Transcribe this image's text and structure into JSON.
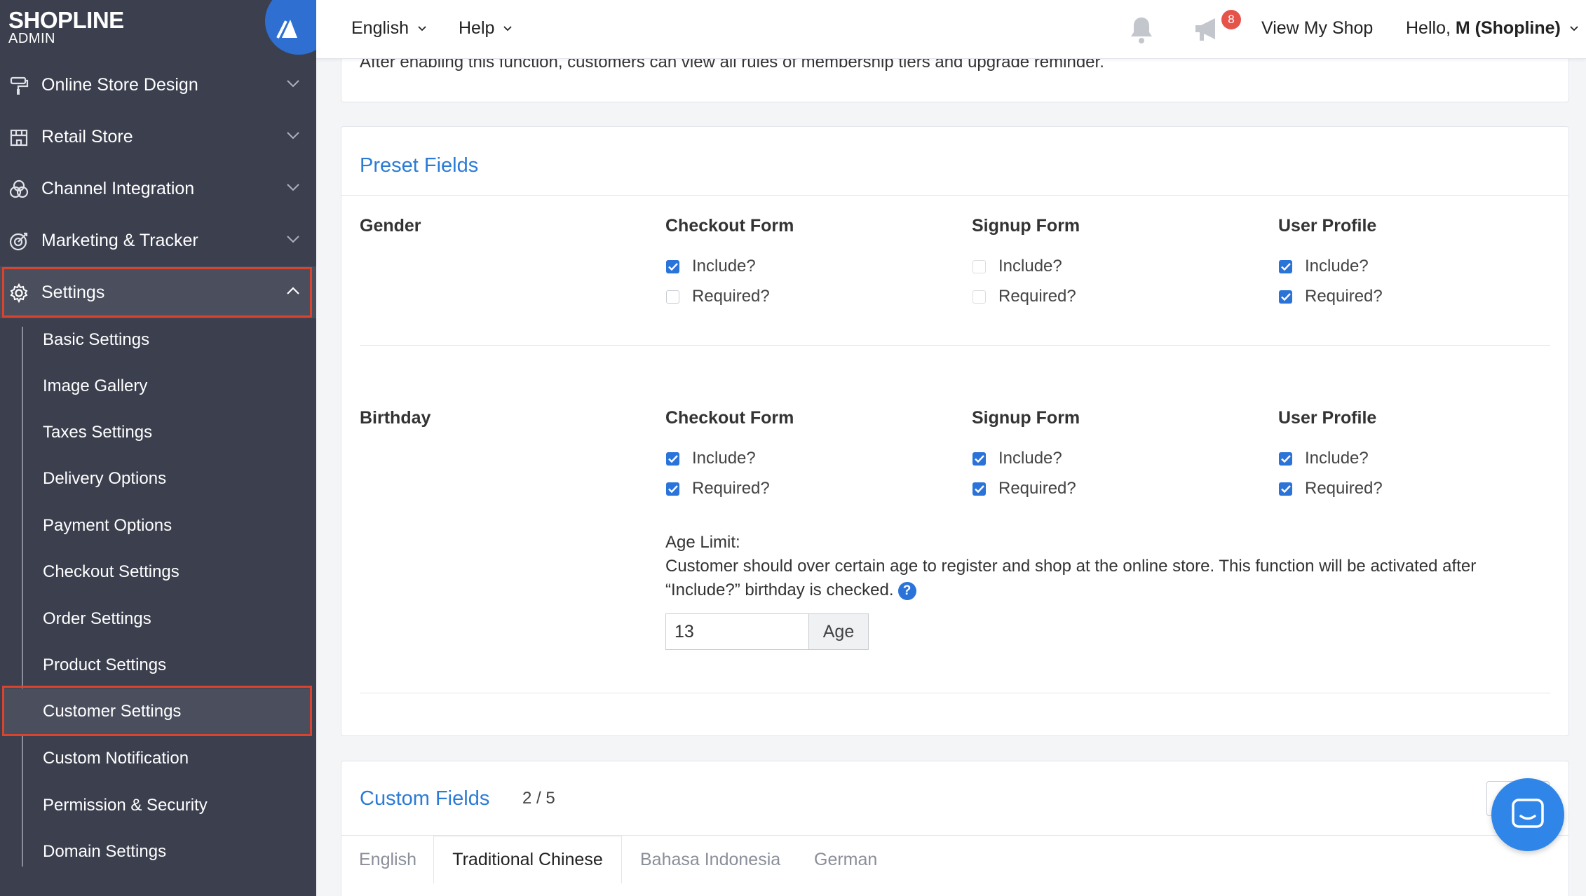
{
  "brand": {
    "name": "SHOPLINE",
    "sub": "ADMIN"
  },
  "sidebar": {
    "items": [
      {
        "label": "Online Store Design"
      },
      {
        "label": "Retail Store"
      },
      {
        "label": "Channel Integration"
      },
      {
        "label": "Marketing & Tracker"
      },
      {
        "label": "Settings"
      }
    ],
    "settings_sub": [
      {
        "label": "Basic Settings"
      },
      {
        "label": "Image Gallery"
      },
      {
        "label": "Taxes Settings"
      },
      {
        "label": "Delivery Options"
      },
      {
        "label": "Payment Options"
      },
      {
        "label": "Checkout Settings"
      },
      {
        "label": "Order Settings"
      },
      {
        "label": "Product Settings"
      },
      {
        "label": "Customer Settings"
      },
      {
        "label": "Custom Notification"
      },
      {
        "label": "Permission & Security"
      },
      {
        "label": "Domain Settings"
      }
    ]
  },
  "topbar": {
    "language": "English",
    "help": "Help",
    "notification_count": "8",
    "view_shop": "View My Shop",
    "greeting": "Hello,",
    "user": "M (Shopline)"
  },
  "main": {
    "top_note": "After enabling this function, customers can view all rules of membership tiers and upgrade reminder.",
    "preset": {
      "title": "Preset Fields",
      "columns": [
        "Checkout Form",
        "Signup Form",
        "User Profile"
      ],
      "include_label": "Include?",
      "required_label": "Required?",
      "gender": {
        "name": "Gender"
      },
      "birthday": {
        "name": "Birthday"
      },
      "age_limit_title": "Age Limit:",
      "age_limit_desc": "Customer should over certain age to register and shop at the online store. This function will be activated after",
      "age_limit_desc2": "“Include?” birthday is checked.",
      "age_value": "13",
      "age_unit": "Age"
    },
    "custom": {
      "title": "Custom Fields",
      "count": "2 / 5",
      "tabs": [
        "English",
        "Traditional Chinese",
        "Bahasa Indonesia",
        "German"
      ]
    }
  },
  "colors": {
    "accent": "#2b7bd6",
    "sidebar": "#3b3f4e",
    "highlight": "#d9442f",
    "badge": "#e5534b"
  }
}
